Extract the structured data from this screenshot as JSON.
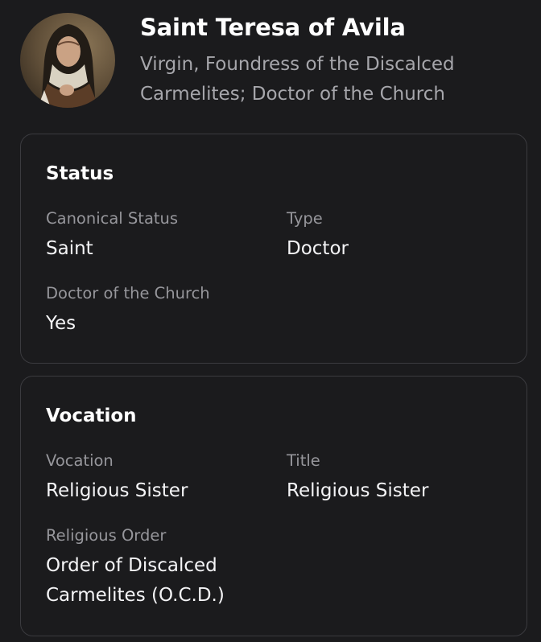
{
  "profile": {
    "name": "Saint Teresa of Avila",
    "description": "Virgin, Foundress of the Discalced Carmelites; Doctor of the Church"
  },
  "status_section": {
    "heading": "Status",
    "canonical_status_label": "Canonical Status",
    "canonical_status_value": "Saint",
    "type_label": "Type",
    "type_value": "Doctor",
    "doctor_label": "Doctor of the Church",
    "doctor_value": "Yes"
  },
  "vocation_section": {
    "heading": "Vocation",
    "vocation_label": "Vocation",
    "vocation_value": "Religious Sister",
    "title_label": "Title",
    "title_value": "Religious Sister",
    "order_label": "Religious Order",
    "order_value": "Order of Discalced Carmelites (O.C.D.)"
  }
}
